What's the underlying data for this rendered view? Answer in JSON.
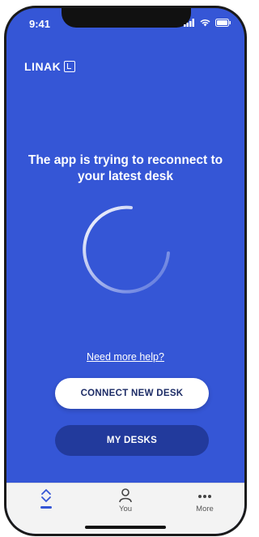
{
  "status_bar": {
    "time": "9:41"
  },
  "brand": {
    "logo_text": "LINAK"
  },
  "main": {
    "title": "The app is trying to reconnect to your latest desk",
    "help_link": "Need more help?",
    "connect_button": "CONNECT NEW DESK",
    "my_desks_button": "MY DESKS"
  },
  "tabbar": {
    "tabs": [
      {
        "label": "",
        "icon": "height-adjust-icon",
        "active": true
      },
      {
        "label": "You",
        "icon": "person-icon",
        "active": false
      },
      {
        "label": "More",
        "icon": "more-dots-icon",
        "active": false
      }
    ]
  },
  "colors": {
    "background": "#3556d6",
    "secondary_button": "#223a9c",
    "tabbar": "#f3f3f3"
  }
}
